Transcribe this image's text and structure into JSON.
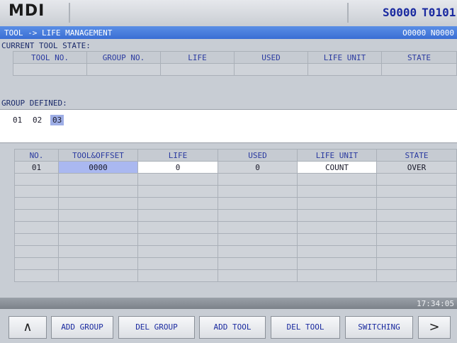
{
  "header": {
    "mode": "MDI",
    "spindle": "S0000",
    "tool": "T0101"
  },
  "pathbar": {
    "path": "TOOL -> LIFE MANAGEMENT",
    "program": "O0000 N0000"
  },
  "current_state": {
    "label": "CURRENT TOOL STATE:",
    "columns": [
      "TOOL NO.",
      "GROUP NO.",
      "LIFE",
      "USED",
      "LIFE UNIT",
      "STATE"
    ]
  },
  "group_defined": {
    "label": "GROUP DEFINED:",
    "groups": [
      "01",
      "02",
      "03"
    ],
    "selected": "03"
  },
  "tool_table": {
    "columns": [
      "NO.",
      "TOOL&OFFSET",
      "LIFE",
      "USED",
      "LIFE UNIT",
      "STATE"
    ],
    "rows": [
      [
        "01",
        "0000",
        "0",
        "0",
        "COUNT",
        "OVER"
      ]
    ]
  },
  "clock": "17:34:05",
  "softkeys": {
    "up_arrow": "∧",
    "add_group": "ADD GROUP",
    "del_group": "DEL GROUP",
    "add_tool": "ADD TOOL",
    "del_tool": "DEL TOOL",
    "switching": "SWITCHING",
    "next_arrow": ">"
  }
}
